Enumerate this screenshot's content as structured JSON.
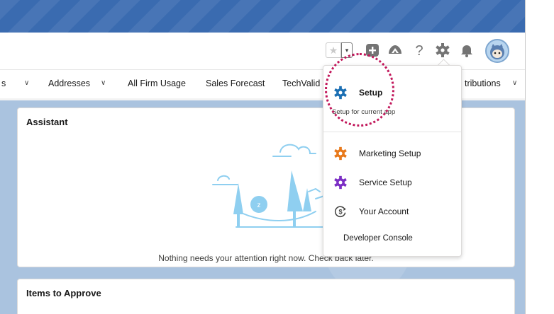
{
  "header": {
    "icons": [
      "star-icon",
      "chevron-down-icon",
      "plus-icon",
      "trailhead-icon",
      "help-icon",
      "gear-icon",
      "bell-icon"
    ],
    "favorite_glyph": "★",
    "dropdown_glyph": "▾"
  },
  "nav": {
    "items": [
      {
        "label": "s"
      },
      {
        "label": "Addresses"
      },
      {
        "label": "All Firm Usage"
      },
      {
        "label": "Sales Forecast"
      },
      {
        "label": "TechValid"
      },
      {
        "label": "tributions"
      }
    ],
    "chevron": "∨"
  },
  "assistant": {
    "title": "Assistant",
    "empty_message": "Nothing needs your attention right now. Check back later."
  },
  "approvals": {
    "title": "Items to Approve"
  },
  "setup_menu": {
    "setup_label": "Setup",
    "setup_subtitle": "Setup for current app",
    "items": [
      {
        "label": "Marketing Setup",
        "icon": "gear-icon",
        "color": "#e8791b"
      },
      {
        "label": "Service Setup",
        "icon": "gear-icon",
        "color": "#7b2ec4"
      },
      {
        "label": "Your Account",
        "icon": "dollar-circle-icon",
        "color": "#3e3e3c"
      }
    ],
    "developer_console": "Developer Console"
  },
  "colors": {
    "brand_band": "#3a6bb0",
    "setup_icon": "#1b6fb3",
    "highlight": "#c2185b",
    "illustration": "#8fcff0"
  }
}
